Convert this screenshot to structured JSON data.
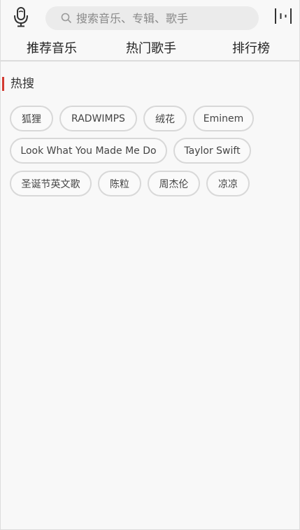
{
  "search": {
    "placeholder": "搜索音乐、专辑、歌手",
    "value": ""
  },
  "header": {
    "mic_icon": "microphone-icon",
    "playing_icon": "now-playing-bars-icon"
  },
  "tabs": [
    {
      "label": "推荐音乐"
    },
    {
      "label": "热门歌手"
    },
    {
      "label": "排行榜"
    }
  ],
  "hot": {
    "title": "热搜",
    "accent": "#d33a31",
    "tags": [
      {
        "label": "狐狸"
      },
      {
        "label": "RADWIMPS"
      },
      {
        "label": "绒花"
      },
      {
        "label": "Eminem"
      },
      {
        "label": "Look What You Made Me Do"
      },
      {
        "label": "Taylor Swift"
      },
      {
        "label": "圣诞节英文歌"
      },
      {
        "label": "陈粒"
      },
      {
        "label": "周杰伦"
      },
      {
        "label": "凉凉"
      }
    ]
  }
}
